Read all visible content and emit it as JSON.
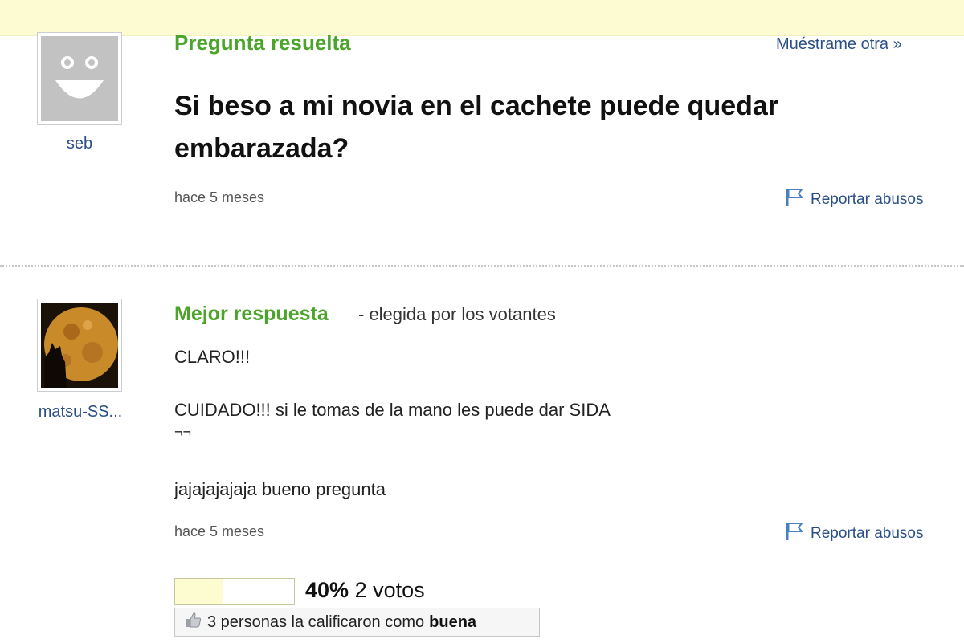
{
  "question": {
    "author": "seb",
    "status": "Pregunta resuelta",
    "show_another": "Muéstrame otra »",
    "title": "Si beso a mi novia en el cachete puede quedar embarazada?",
    "time": "hace 5 meses",
    "report": "Reportar abusos"
  },
  "answer": {
    "author": "matsu-SS...",
    "label": "Mejor respuesta",
    "chosen_by": "- elegida por los votantes",
    "lines": [
      "CLARO!!!",
      "CUIDADO!!! si le tomas de la mano les puede dar SIDA",
      "¬¬",
      "jajajajajaja bueno pregunta"
    ],
    "time": "hace 5 meses",
    "report": "Reportar abusos",
    "vote_percent": "40%",
    "vote_fraction": 0.4,
    "votes": "2 votos",
    "rating_prefix": "3 personas la calificaron como",
    "rating_word": "buena"
  },
  "colors": {
    "topbar": "#fcfbd2",
    "green": "#4ca52a",
    "link": "#2a4f86"
  },
  "icons": [
    "smiley-avatar-icon",
    "moon-wolf-avatar-icon",
    "flag-icon",
    "thumbs-up-icon"
  ]
}
